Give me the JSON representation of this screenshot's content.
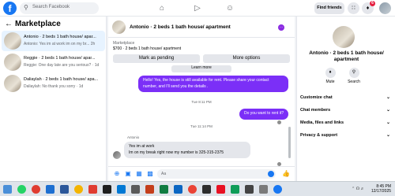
{
  "topbar": {
    "search_placeholder": "Search Facebook",
    "find_friends": "Find friends",
    "notification_count": "6"
  },
  "left": {
    "heading": "Marketplace",
    "conversations": [
      {
        "title": "Antonio · 2 beds 1 bath house/ apar...",
        "snippet": "Antonio: Yes im at work im on my br... 2h"
      },
      {
        "title": "Reggie · 2 beds 1 bath house/ apar...",
        "snippet": "Reggie: One day late are you serious? · 1d"
      },
      {
        "title": "Daliaylah · 2 beds 1 bath house/ apa...",
        "snippet": "Daliaylah: No thank you sorry · 1d"
      }
    ]
  },
  "chat": {
    "title": "Antonio · 2 beds 1 bath house/ apartment",
    "listing_label": "Marketplace",
    "listing_value": "$700 · 2 beds 1 bath house/ apartment",
    "mark_pending": "Mark as pending",
    "more_options": "More options",
    "learn_more": "Learn more",
    "msg_out_1": "Hello! Yes, the house is still available for rent. Please share your contact number, and I'll send you the details .",
    "time_1": "Tue 8:11 PM",
    "msg_out_2": "Do you want to rent it?",
    "time_2": "Tue 11:14 PM",
    "sender": "Antonio",
    "msg_in_1": "Yes im at work",
    "msg_in_2": "Im on my break right now my number is 325-315-2375",
    "composer_placeholder": "Aa"
  },
  "right": {
    "title": "Antonio · 2 beds 1 bath house/ apartment",
    "mute": "Mute",
    "search": "Search",
    "rows": [
      "Customize chat",
      "Chat members",
      "Media, files and links",
      "Privacy & support"
    ]
  },
  "taskbar": {
    "time": "8:45 PM",
    "date": "12/17/2025"
  }
}
